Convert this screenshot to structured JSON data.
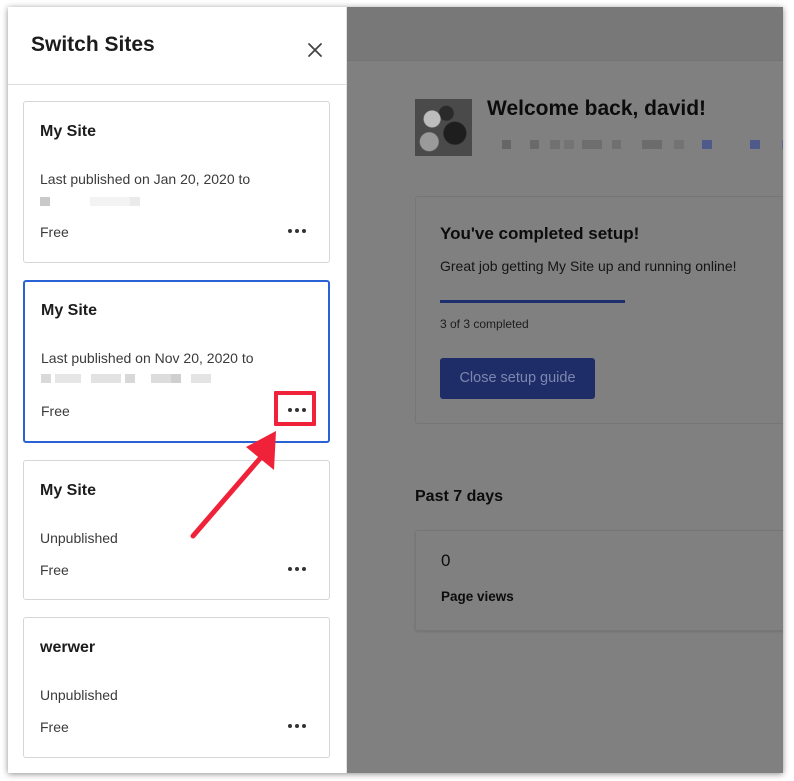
{
  "panel": {
    "title": "Switch Sites",
    "sites": [
      {
        "name": "My Site",
        "status": "Last published on Jan 20, 2020 to",
        "plan": "Free"
      },
      {
        "name": "My Site",
        "status": "Last published on Nov 20, 2020 to",
        "plan": "Free"
      },
      {
        "name": "My Site",
        "status": "Unpublished",
        "plan": "Free"
      },
      {
        "name": "werwer",
        "status": "Unpublished",
        "plan": "Free"
      }
    ]
  },
  "dashboard": {
    "welcome": "Welcome back, david!",
    "setup": {
      "title": "You've completed setup!",
      "subtitle": "Great job getting My Site up and running online!",
      "progress_text": "3 of 3 completed",
      "progress_fraction": 1.0,
      "close_label": "Close setup guide"
    },
    "stats": {
      "period_label": "Past 7 days",
      "page_views_value": "0",
      "page_views_label": "Page views"
    }
  },
  "colors": {
    "accent_blue": "#2a62d6",
    "button_blue": "#1e2d68",
    "annotation_red": "#f0223a",
    "overlay_gray": "#808080"
  },
  "icons": {
    "close": "close-icon",
    "more": "more-horizontal-icon",
    "annotation": "red-arrow"
  }
}
